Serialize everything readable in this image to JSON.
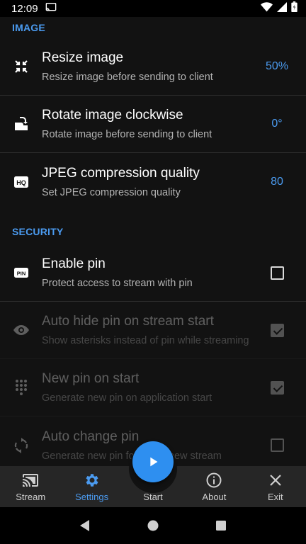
{
  "status_bar": {
    "time": "12:09"
  },
  "sections": {
    "image": "IMAGE",
    "security": "SECURITY"
  },
  "image_settings": [
    {
      "icon": "resize-icon",
      "title": "Resize image",
      "subtitle": "Resize image before sending to client",
      "value": "50%"
    },
    {
      "icon": "rotate-icon",
      "title": "Rotate image clockwise",
      "subtitle": "Rotate image before sending to client",
      "value": "0°"
    },
    {
      "icon": "hq-icon",
      "title": "JPEG compression quality",
      "subtitle": "Set JPEG compression quality",
      "value": "80"
    }
  ],
  "security_settings": [
    {
      "icon": "pin-icon",
      "title": "Enable pin",
      "subtitle": "Protect access to stream with pin",
      "checked": false,
      "enabled": true
    },
    {
      "icon": "eye-icon",
      "title": "Auto hide pin on stream start",
      "subtitle": "Show asterisks instead of pin while streaming",
      "checked": true,
      "enabled": false
    },
    {
      "icon": "dialpad-icon",
      "title": "New pin on start",
      "subtitle": "Generate new pin on application start",
      "checked": true,
      "enabled": false
    },
    {
      "icon": "autorenew-icon",
      "title": "Auto change pin",
      "subtitle": "Generate new pin for every new stream",
      "checked": false,
      "enabled": false
    }
  ],
  "bottom_nav": [
    {
      "id": "stream",
      "label": "Stream",
      "icon": "cast-icon"
    },
    {
      "id": "settings",
      "label": "Settings",
      "icon": "gear-icon",
      "active": true
    },
    {
      "id": "start",
      "label": "Start",
      "icon": "play-icon"
    },
    {
      "id": "about",
      "label": "About",
      "icon": "info-icon"
    },
    {
      "id": "exit",
      "label": "Exit",
      "icon": "close-icon"
    }
  ],
  "colors": {
    "accent": "#4b9bf0",
    "fab": "#2e8ff0",
    "background": "#121212",
    "nav_bar": "#262626"
  }
}
